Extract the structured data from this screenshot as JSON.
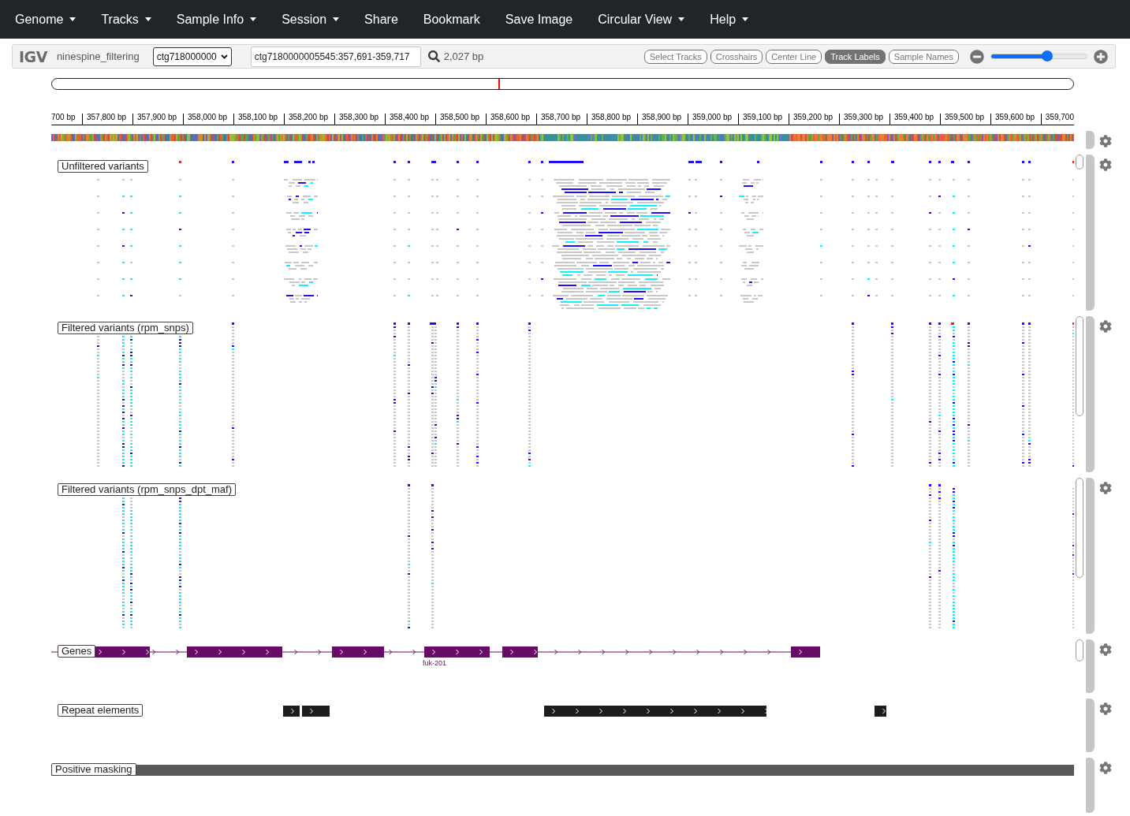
{
  "navbar": {
    "items": [
      {
        "label": "Genome",
        "dropdown": true
      },
      {
        "label": "Tracks",
        "dropdown": true
      },
      {
        "label": "Sample Info",
        "dropdown": true
      },
      {
        "label": "Session",
        "dropdown": true
      },
      {
        "label": "Share",
        "dropdown": false
      },
      {
        "label": "Bookmark",
        "dropdown": false
      },
      {
        "label": "Save Image",
        "dropdown": false
      },
      {
        "label": "Circular View",
        "dropdown": true
      },
      {
        "label": "Help",
        "dropdown": true
      }
    ]
  },
  "toolbar": {
    "logo": "IGV",
    "genome": "ninespine_filtering",
    "chromosome": "ctg718000000",
    "locus": "ctg7180000005545:357,691-359,717",
    "window_size": "2,027 bp",
    "toggles": [
      {
        "label": "Select Tracks",
        "selected": false
      },
      {
        "label": "Crosshairs",
        "selected": false
      },
      {
        "label": "Center Line",
        "selected": false
      },
      {
        "label": "Track Labels",
        "selected": true
      },
      {
        "label": "Sample Names",
        "selected": false
      }
    ],
    "zoom": {
      "level": 0.59
    }
  },
  "chromosome_overview": {
    "level": 0.438
  },
  "ruler": {
    "labels": [
      "700 bp",
      "357,800 bp",
      "357,900 bp",
      "358,000 bp",
      "358,100 bp",
      "358,200 bp",
      "358,300 bp",
      "358,400 bp",
      "358,500 bp",
      "358,600 bp",
      "358,700 bp",
      "358,800 bp",
      "358,900 bp",
      "359,000 bp",
      "359,100 bp",
      "359,200 bp",
      "359,300 bp",
      "359,400 bp",
      "359,500 bp",
      "359,600 bp",
      "359,700"
    ]
  },
  "tracks": [
    {
      "kind": "sequence"
    },
    {
      "kind": "variants_expanded",
      "name": "Unfiltered variants"
    },
    {
      "kind": "variants_squished",
      "name": "Filtered variants (rpm_snps)"
    },
    {
      "kind": "variants_squished",
      "name": "Filtered variants (rpm_snps_dpt_maf)"
    },
    {
      "kind": "genes",
      "name": "Genes",
      "feature_label": "fuk-201"
    },
    {
      "kind": "repeats",
      "name": "Repeat elements"
    },
    {
      "kind": "masking",
      "name": "Positive masking"
    }
  ]
}
